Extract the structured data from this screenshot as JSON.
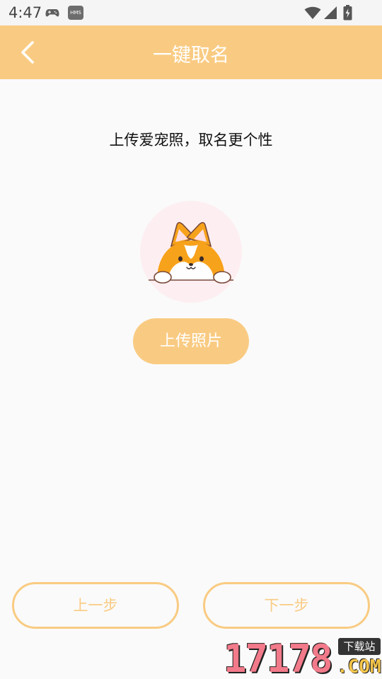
{
  "status_bar": {
    "time": "4:47",
    "hms_label": "HMS",
    "icons": [
      "gamepad-icon",
      "wifi-icon",
      "signal-icon",
      "battery-icon"
    ]
  },
  "header": {
    "title": "一键取名",
    "back_icon": "chevron-left-icon",
    "background": "#f9cb82"
  },
  "main": {
    "tagline": "上传爱宠照，取名更个性",
    "upload_label": "上传照片",
    "avatar_bg": "#fdeef1"
  },
  "footer": {
    "prev_label": "上一步",
    "next_label": "下一步"
  },
  "watermark": {
    "number": "17178",
    "tag": "下载站",
    "domain": ".COM"
  },
  "colors": {
    "accent": "#f9cb82",
    "pet_orange": "#f7a21b"
  }
}
